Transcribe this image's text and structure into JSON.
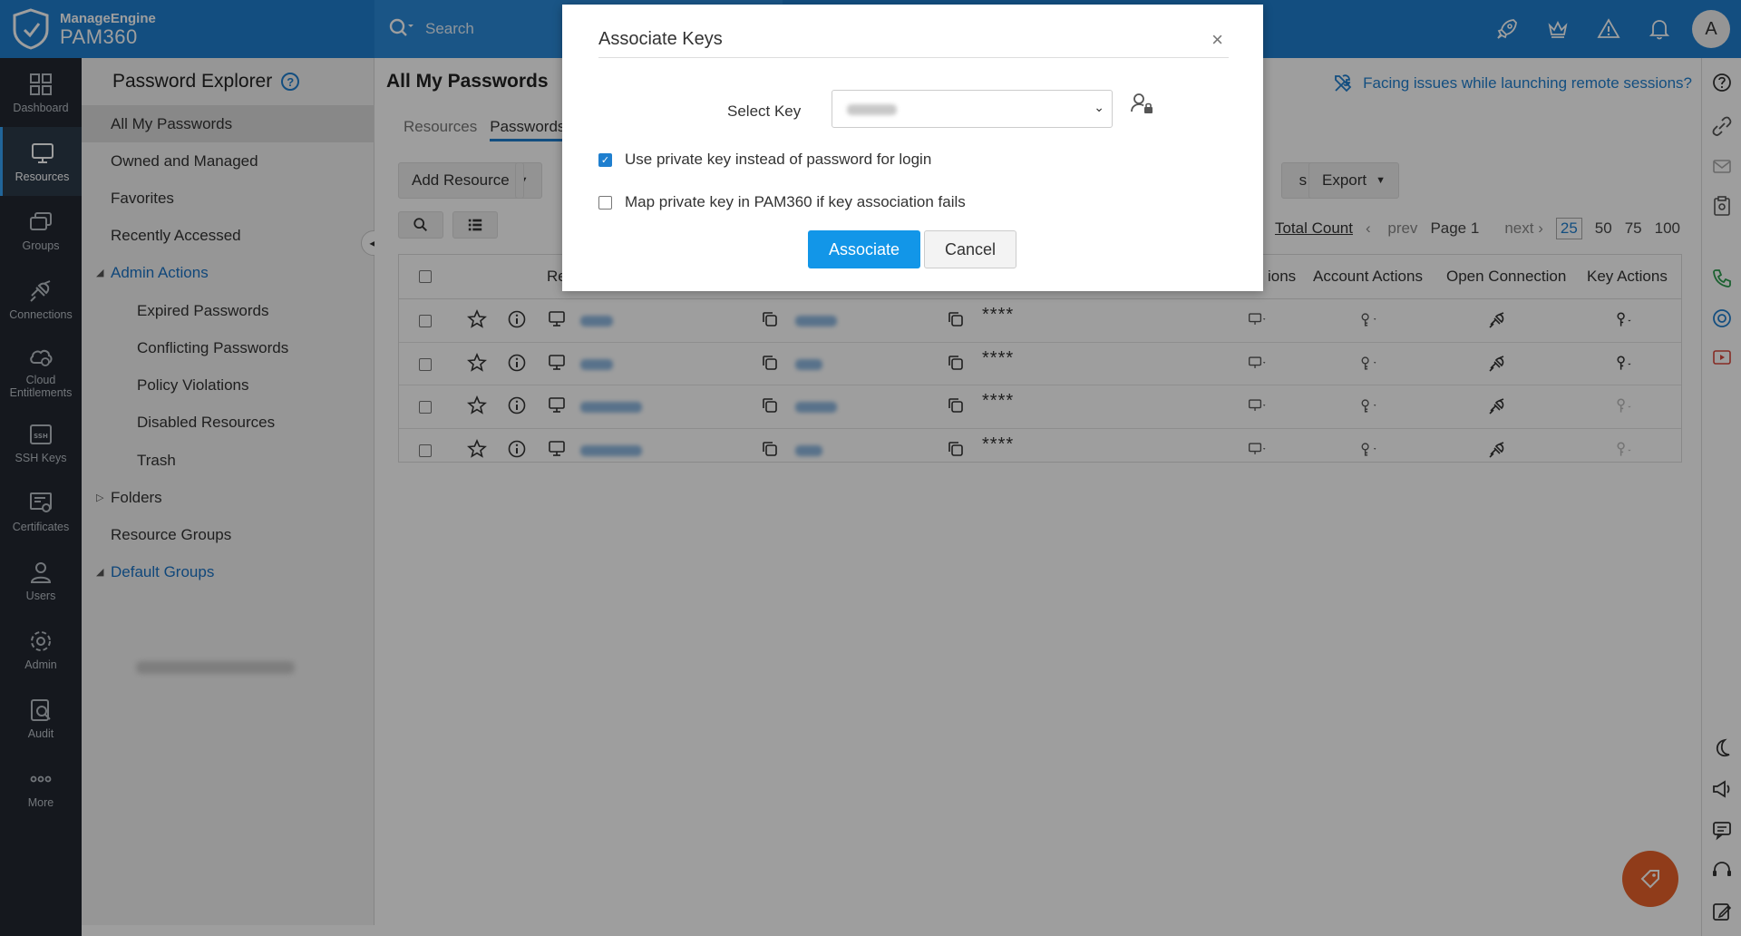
{
  "header": {
    "brand": "ManageEngine",
    "product": "PAM360",
    "search_label": "Search",
    "avatar_letter": "A",
    "accent": "#1f7fcf"
  },
  "leftnav": {
    "items": [
      {
        "label": "Dashboard",
        "icon": "dashboard-icon"
      },
      {
        "label": "Resources",
        "icon": "monitor-icon"
      },
      {
        "label": "Groups",
        "icon": "groups-icon"
      },
      {
        "label": "Connections",
        "icon": "connections-icon"
      },
      {
        "label": "Cloud Entitlements",
        "icon": "cloud-icon"
      },
      {
        "label": "SSH Keys",
        "icon": "ssh-icon"
      },
      {
        "label": "Certificates",
        "icon": "certificate-icon"
      },
      {
        "label": "Users",
        "icon": "user-icon"
      },
      {
        "label": "Admin",
        "icon": "gear-icon"
      },
      {
        "label": "Audit",
        "icon": "audit-icon"
      },
      {
        "label": "More",
        "icon": "more-icon"
      }
    ]
  },
  "explorer": {
    "title": "Password Explorer",
    "help": "?",
    "all_my_passwords": "All My Passwords",
    "owned_and_managed": "Owned and Managed",
    "favorites": "Favorites",
    "recently_accessed": "Recently Accessed",
    "admin_actions": "Admin Actions",
    "expired": "Expired Passwords",
    "conflicting": "Conflicting Passwords",
    "policy": "Policy Violations",
    "disabled": "Disabled Resources",
    "trash": "Trash",
    "folders": "Folders",
    "resource_groups": "Resource Groups",
    "default_groups": "Default Groups"
  },
  "main": {
    "title": "All My Passwords",
    "facing": "Facing issues while launching remote sessions?",
    "tabs": [
      "Resources",
      "Passwords"
    ],
    "add_resource": "Add Resource",
    "export": "Export",
    "partial_btn": "s",
    "pager": {
      "total_count": "Total Count",
      "prev": "prev",
      "page": "Page 1",
      "next": "next",
      "sizes": [
        "25",
        "50",
        "75",
        "100"
      ]
    },
    "columns": {
      "resource": "Re",
      "actions_partial": "ions",
      "account_actions": "Account Actions",
      "open_connection": "Open Connection",
      "key_actions": "Key Actions"
    },
    "mask": "****"
  },
  "modal": {
    "title": "Associate Keys",
    "close": "×",
    "select_label": "Select Key",
    "use_private_key": "Use private key instead of password for login",
    "map_private_key": "Map private key in PAM360 if key association fails",
    "associate": "Associate",
    "cancel": "Cancel"
  }
}
